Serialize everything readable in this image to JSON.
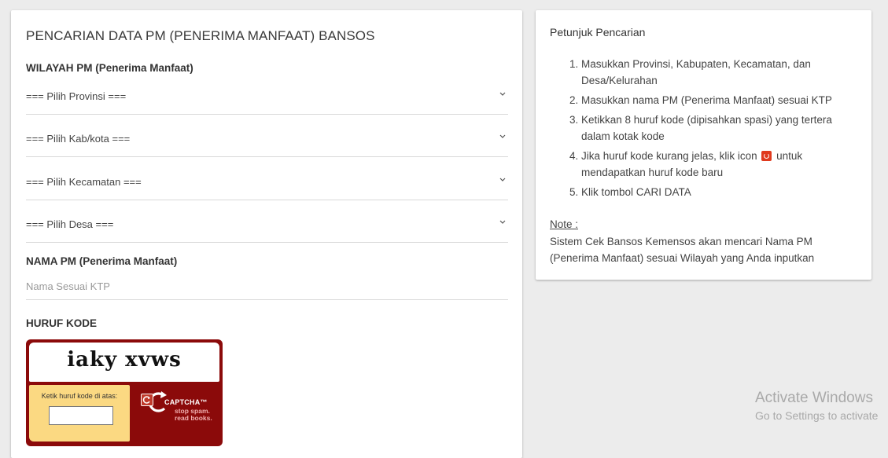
{
  "form": {
    "title": "PENCARIAN DATA PM (PENERIMA MANFAAT) BANSOS",
    "region_label": "WILAYAH PM (Penerima Manfaat)",
    "selects": {
      "province": "=== Pilih Provinsi ===",
      "regency": "=== Pilih Kab/kota ===",
      "district": "=== Pilih Kecamatan ===",
      "village": "=== Pilih Desa ==="
    },
    "name_label": "NAMA PM (Penerima Manfaat)",
    "name_placeholder": "Nama Sesuai KTP",
    "code_label": "HURUF KODE",
    "captcha": {
      "word": "iaky xvws",
      "entry_label": "Ketik huruf kode di atas:",
      "brand": "CAPTCHA™",
      "tagline_1": "stop spam.",
      "tagline_2": "read books."
    }
  },
  "guide": {
    "title": "Petunjuk Pencarian",
    "steps": [
      "Masukkan Provinsi, Kabupaten, Kecamatan, dan Desa/Kelurahan",
      "Masukkan nama PM (Penerima Manfaat) sesuai KTP",
      "Ketikkan 8 huruf kode (dipisahkan spasi) yang tertera dalam kotak kode"
    ],
    "step4_before": "Jika huruf kode kurang jelas, klik icon",
    "step4_after": "untuk mendapatkan huruf kode baru",
    "step5": "Klik tombol CARI DATA",
    "note_title": "Note :",
    "note_body": "Sistem Cek Bansos Kemensos akan mencari Nama PM (Penerima Manfaat) sesuai Wilayah yang Anda inputkan"
  },
  "watermark": {
    "title": "Activate Windows",
    "subtitle": "Go to Settings to activate"
  },
  "colors": {
    "captcha_frame": "#8b0a0a",
    "captcha_entry": "#fbd982",
    "refresh_icon": "#e03a1e"
  }
}
